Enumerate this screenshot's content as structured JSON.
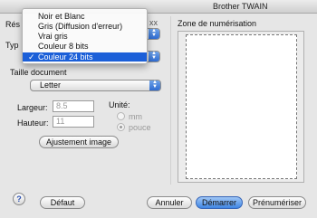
{
  "window": {
    "title": "Brother TWAIN"
  },
  "settings": {
    "resolution_label_partial": "Rés",
    "resolution_value_partial": "xx",
    "type_label_partial": "Typ",
    "document_size_label": "Taille document",
    "document_size_value": "Letter",
    "width_label": "Largeur:",
    "width_value": "8.5",
    "height_label": "Hauteur:",
    "height_value": "11",
    "unit_label": "Unité:",
    "unit_options": [
      "mm",
      "pouce"
    ],
    "unit_selected": "pouce",
    "fit_image_button": "Ajustement image"
  },
  "scan_zone": {
    "label": "Zone de numérisation"
  },
  "type_menu": {
    "items": [
      "Noir et Blanc",
      "Gris (Diffusion d'erreur)",
      "Vrai gris",
      "Couleur 8 bits",
      "Couleur 24 bits"
    ],
    "selected": "Couleur 24 bits",
    "check_glyph": "✓"
  },
  "footer": {
    "help_icon": "?",
    "default_button": "Défaut",
    "cancel_button": "Annuler",
    "start_button": "Démarrer",
    "prescan_button": "Prénumériser"
  },
  "colors": {
    "accent": "#1b5fd8",
    "default_button": "#3f86e4"
  }
}
